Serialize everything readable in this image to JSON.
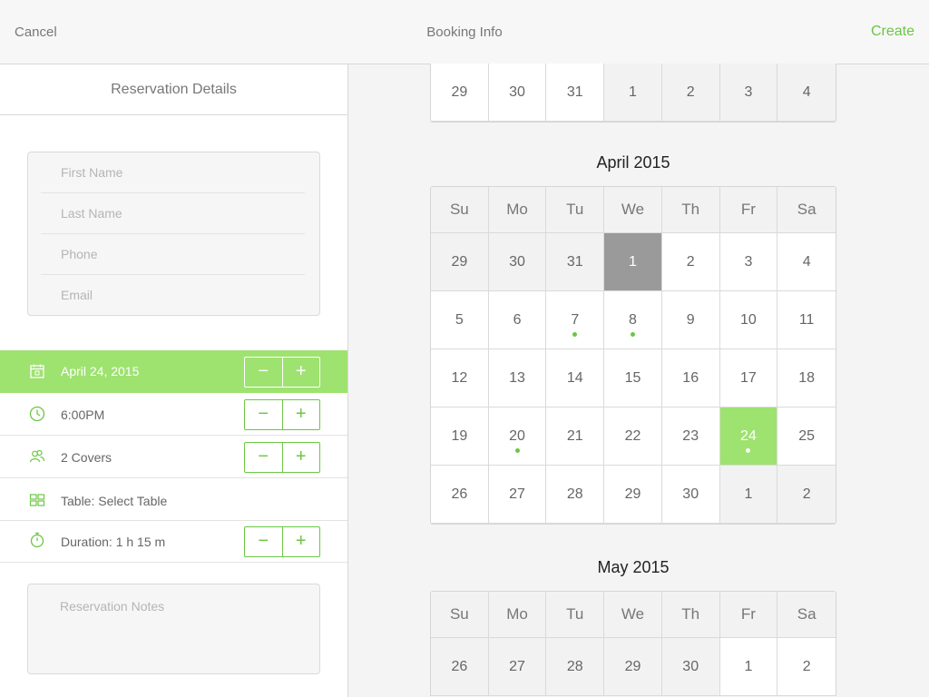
{
  "topbar": {
    "cancel": "Cancel",
    "title": "Booking Info",
    "create": "Create"
  },
  "left": {
    "header": "Reservation Details",
    "fields": {
      "first": "First Name",
      "last": "Last Name",
      "phone": "Phone",
      "email": "Email"
    },
    "rows": {
      "date": "April 24, 2015",
      "time": "6:00PM",
      "covers": "2 Covers",
      "table": "Table: Select Table",
      "duration": "Duration: 1 h 15 m"
    },
    "stepper": {
      "minus": "−",
      "plus": "+"
    },
    "notes_placeholder": "Reservation Notes"
  },
  "calendar": {
    "day_headers": [
      "Su",
      "Mo",
      "Tu",
      "We",
      "Th",
      "Fr",
      "Sa"
    ],
    "march_tail": [
      {
        "d": "29",
        "s": "in"
      },
      {
        "d": "30",
        "s": "in"
      },
      {
        "d": "31",
        "s": "in"
      },
      {
        "d": "1",
        "s": "out"
      },
      {
        "d": "2",
        "s": "out"
      },
      {
        "d": "3",
        "s": "out"
      },
      {
        "d": "4",
        "s": "out"
      }
    ],
    "april": {
      "title": "April 2015",
      "days": [
        {
          "d": "29",
          "s": "out"
        },
        {
          "d": "30",
          "s": "out"
        },
        {
          "d": "31",
          "s": "out"
        },
        {
          "d": "1",
          "s": "gray"
        },
        {
          "d": "2",
          "s": "in"
        },
        {
          "d": "3",
          "s": "in"
        },
        {
          "d": "4",
          "s": "in"
        },
        {
          "d": "5",
          "s": "in"
        },
        {
          "d": "6",
          "s": "in"
        },
        {
          "d": "7",
          "s": "in",
          "dot": true
        },
        {
          "d": "8",
          "s": "in",
          "dot": true
        },
        {
          "d": "9",
          "s": "in"
        },
        {
          "d": "10",
          "s": "in"
        },
        {
          "d": "11",
          "s": "in"
        },
        {
          "d": "12",
          "s": "in"
        },
        {
          "d": "13",
          "s": "in"
        },
        {
          "d": "14",
          "s": "in"
        },
        {
          "d": "15",
          "s": "in"
        },
        {
          "d": "16",
          "s": "in"
        },
        {
          "d": "17",
          "s": "in"
        },
        {
          "d": "18",
          "s": "in"
        },
        {
          "d": "19",
          "s": "in"
        },
        {
          "d": "20",
          "s": "in",
          "dot": true
        },
        {
          "d": "21",
          "s": "in"
        },
        {
          "d": "22",
          "s": "in"
        },
        {
          "d": "23",
          "s": "in"
        },
        {
          "d": "24",
          "s": "green",
          "dot": true
        },
        {
          "d": "25",
          "s": "in"
        },
        {
          "d": "26",
          "s": "in"
        },
        {
          "d": "27",
          "s": "in"
        },
        {
          "d": "28",
          "s": "in"
        },
        {
          "d": "29",
          "s": "in"
        },
        {
          "d": "30",
          "s": "in"
        },
        {
          "d": "1",
          "s": "out"
        },
        {
          "d": "2",
          "s": "out"
        }
      ]
    },
    "may": {
      "title": "May 2015",
      "days": [
        {
          "d": "26",
          "s": "out"
        },
        {
          "d": "27",
          "s": "out"
        },
        {
          "d": "28",
          "s": "out"
        },
        {
          "d": "29",
          "s": "out"
        },
        {
          "d": "30",
          "s": "out"
        },
        {
          "d": "1",
          "s": "in"
        },
        {
          "d": "2",
          "s": "in"
        }
      ]
    }
  }
}
